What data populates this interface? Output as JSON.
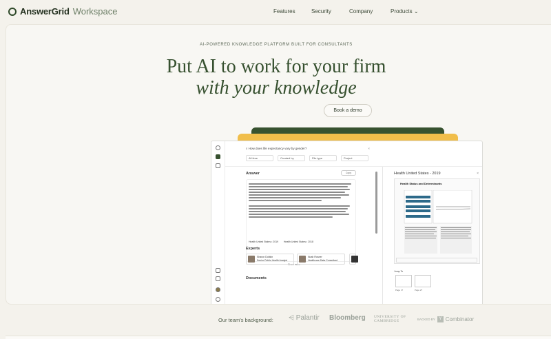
{
  "brand": {
    "name": "AnswerGrid",
    "suffix": "Workspace"
  },
  "nav": {
    "features": "Features",
    "security": "Security",
    "company": "Company",
    "products": "Products"
  },
  "hero": {
    "eyebrow": "AI-POWERED KNOWLEDGE PLATFORM BUILT FOR CONSULTANTS",
    "headline": "Put AI to work for your firm",
    "headline_italic": "with your knowledge",
    "cta": "Book a demo"
  },
  "app": {
    "search_query": "How does life expectancy vary by gender?",
    "filters": [
      "All time",
      "Created by",
      "File type",
      "Project"
    ],
    "answer_title": "Answer",
    "copy_label": "Copy",
    "refs": [
      "Health United States • 2019",
      "Health United States • 2018"
    ],
    "show_more": "Show more",
    "experts_title": "Experts",
    "experts": [
      {
        "name": "Sharon Dobkin",
        "role": "Senior Public Health Analyst"
      },
      {
        "name": "Noah Rosner",
        "role": "Healthcare Data Consultant"
      }
    ],
    "documents_title": "Documents",
    "panel_title": "Health United States - 2019",
    "doc_heading": "Health Status and Determinants",
    "jump_label": "Jump To",
    "thumbs": [
      "Page 17",
      "Page 27"
    ]
  },
  "background": {
    "title": "Our team's background:",
    "logos": [
      "Palantir",
      "Bloomberg",
      "UNIVERSITY OF CAMBRIDGE",
      "Combinator"
    ],
    "yc_prefix": "BACKED BY",
    "yc_letter": "Y"
  },
  "colors": {
    "brand_green": "#36502f",
    "accent_yellow": "#f1be4a",
    "background": "#f4f2ec"
  }
}
